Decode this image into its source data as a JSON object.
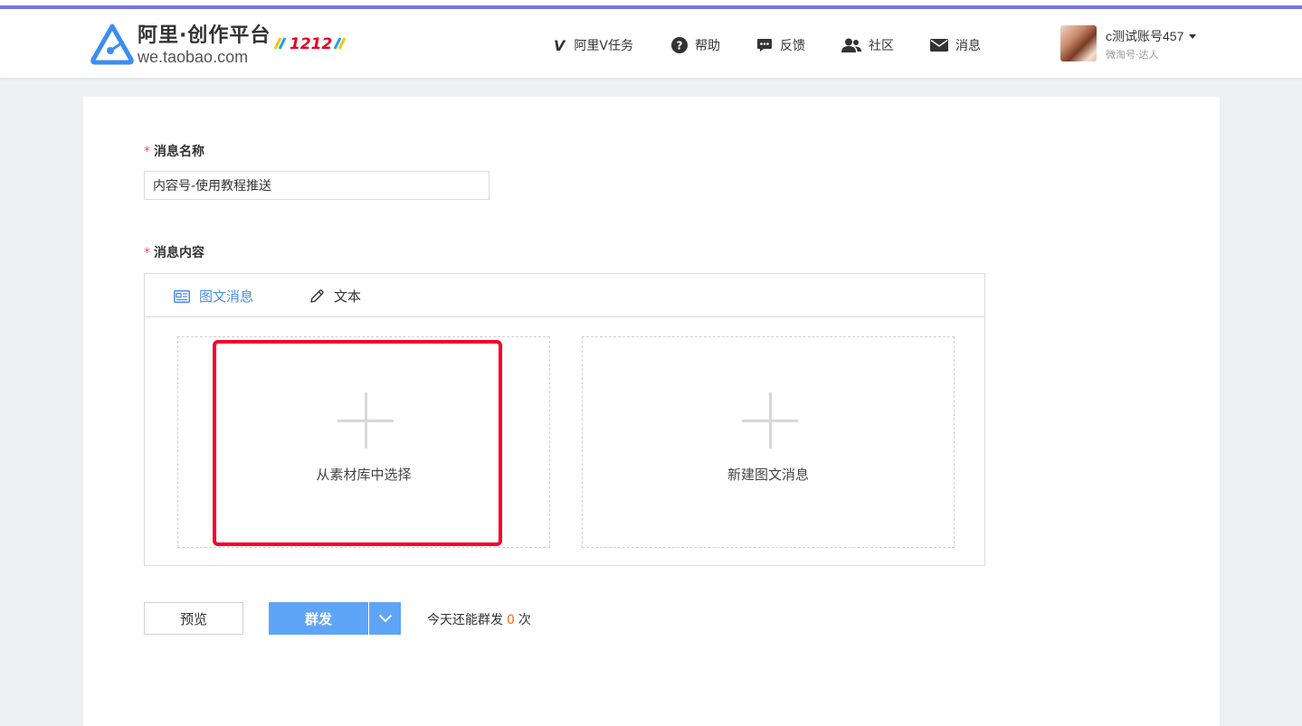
{
  "header": {
    "logo_title": "阿里·创作平台",
    "logo_url": "we.taobao.com",
    "event_badge": "1212",
    "nav": [
      {
        "id": "vtask",
        "icon": "v-logo-icon",
        "label": "阿里V任务"
      },
      {
        "id": "help",
        "icon": "question-circle-icon",
        "label": "帮助"
      },
      {
        "id": "feedback",
        "icon": "chat-bubble-icon",
        "label": "反馈"
      },
      {
        "id": "community",
        "icon": "users-icon",
        "label": "社区"
      },
      {
        "id": "messages",
        "icon": "envelope-icon",
        "label": "消息"
      }
    ],
    "user": {
      "name": "c测试账号457",
      "role": "微淘号·达人"
    }
  },
  "form": {
    "name_label": "消息名称",
    "name_value": "内容号-使用教程推送",
    "content_label": "消息内容",
    "tabs": [
      {
        "icon": "card-icon",
        "label": "图文消息",
        "active": true
      },
      {
        "icon": "pencil-icon",
        "label": "文本",
        "active": false
      }
    ],
    "options": {
      "library": "从素材库中选择",
      "create": "新建图文消息"
    }
  },
  "actions": {
    "preview": "预览",
    "send": "群发",
    "quota_prefix": "今天还能群发",
    "quota_count": "0",
    "quota_suffix": "次"
  },
  "colors": {
    "accent_bar": "#7b73e6",
    "primary": "#5ea4f7",
    "active_tab": "#4a90e2",
    "highlight": "#f5002b",
    "required_star": "#f04864",
    "quota_count": "#ff6600"
  }
}
